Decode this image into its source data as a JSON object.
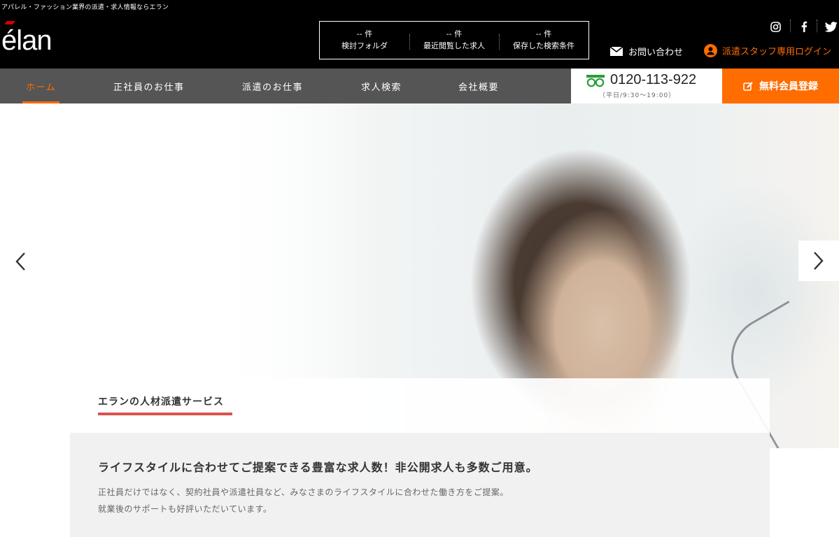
{
  "header": {
    "tagline": "アパレル・ファッション業界の派遣・求人情報ならエラン",
    "logo_text": "élan",
    "counters": [
      {
        "count": "-- 件",
        "label": "検討フォルダ"
      },
      {
        "count": "-- 件",
        "label": "最近閲覧した求人"
      },
      {
        "count": "-- 件",
        "label": "保存した検索条件"
      }
    ],
    "social_icons": [
      "instagram-icon",
      "facebook-icon",
      "twitter-icon"
    ],
    "contact_label": "お問い合わせ",
    "staff_login_label": "派遣スタッフ専用ログイン"
  },
  "nav": {
    "items": [
      {
        "label": "ホーム",
        "active": true
      },
      {
        "label": "正社員のお仕事",
        "active": false
      },
      {
        "label": "派遣のお仕事",
        "active": false
      },
      {
        "label": "求人検索",
        "active": false
      },
      {
        "label": "会社概要",
        "active": false
      }
    ],
    "phone_number": "0120-113-922",
    "phone_hours": "（平日/9:30〜19:00）",
    "register_label": "無料会員登録"
  },
  "service": {
    "title": "エランの人材派遣サービス",
    "lead": "ライフスタイルに合わせてご提案できる豊富な求人数！非公開求人も多数ご用意。",
    "text_lines": [
      "正社員だけではなく、契約社員や派遣社員など、みなさまのライフスタイルに合わせた働き方をご提案。",
      "就業後のサポートも好評いただいています。"
    ]
  },
  "colors": {
    "accent": "#ff6c00",
    "header_bg": "#000000",
    "nav_bg": "#555555",
    "underline": "#d9534f"
  }
}
